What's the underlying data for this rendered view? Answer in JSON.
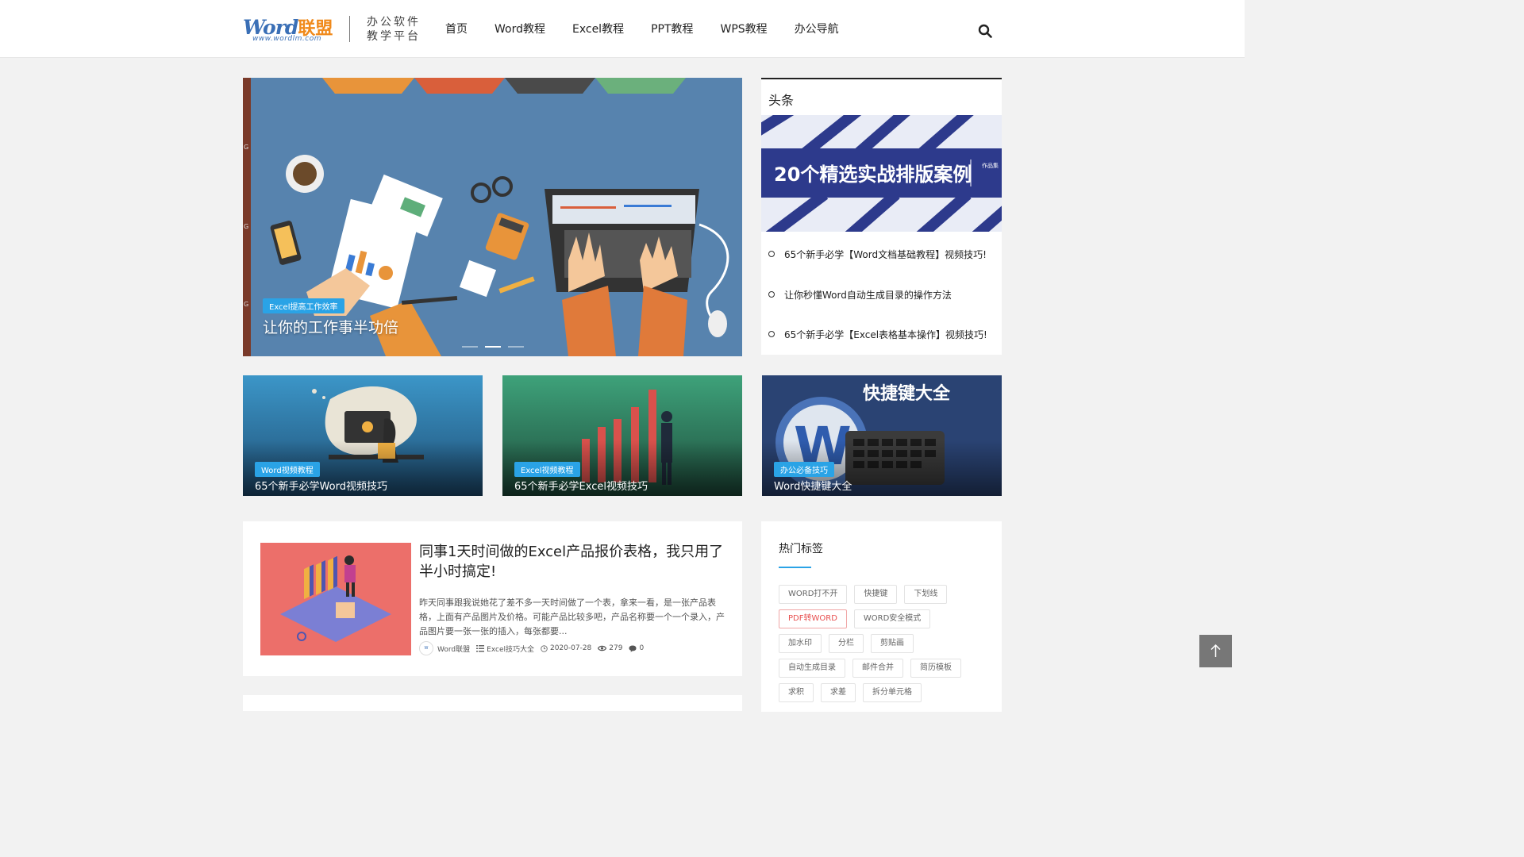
{
  "header": {
    "logo_word": "Word",
    "logo_lm": "联盟",
    "logo_url": "www.wordlm.com",
    "slogan_line1": "办公软件",
    "slogan_line2": "教学平台",
    "nav": [
      "首页",
      "Word教程",
      "Excel教程",
      "PPT教程",
      "WPS教程",
      "办公导航"
    ],
    "search_icon": "search-icon"
  },
  "hero": {
    "tag": "Excel提高工作效率",
    "title": "让你的工作事半功倍",
    "slide_count": 3,
    "active_slide": 2
  },
  "headlines": {
    "title": "头条",
    "banner_text": "20个精选实战排版案例",
    "banner_side": "作品集",
    "items": [
      "65个新手必学【Word文档基础教程】视频技巧!",
      "让你秒懂Word自动生成目录的操作方法",
      "65个新手必学【Excel表格基本操作】视频技巧!"
    ]
  },
  "cards": [
    {
      "tag": "Word视频教程",
      "title": "65个新手必学Word视频技巧"
    },
    {
      "tag": "Excel视频教程",
      "title": "65个新手必学Excel视频技巧"
    },
    {
      "tag": "办公必备技巧",
      "title": "Word快捷键大全",
      "image_text": "快捷键大全"
    }
  ],
  "article": {
    "title": "同事1天时间做的Excel产品报价表格，我只用了半小时搞定!",
    "excerpt": "昨天同事跟我说她花了差不多一天时间做了一个表，拿来一看，是一张产品表格，上面有产品图片及价格。可能产品比较多吧，产品名称要一个一个录入，产品图片要一张一张的插入，每张都要...",
    "author": "Word联盟",
    "category": "Excel技巧大全",
    "date": "2020-07-28",
    "views": "279",
    "comments": "0"
  },
  "hot_tags": {
    "title": "热门标签",
    "rows": [
      [
        "WORD打不开",
        "快捷键",
        "下划线"
      ],
      [
        "PDF转WORD",
        "WORD安全模式"
      ],
      [
        "加水印",
        "分栏",
        "剪贴画"
      ],
      [
        "自动生成目录",
        "邮件合并",
        "简历模板"
      ],
      [
        "求积",
        "求差",
        "拆分单元格"
      ]
    ],
    "highlight": "PDF转WORD"
  },
  "colors": {
    "accent": "#2aa3e6",
    "hero_bg": "#5783ae",
    "hot_tag": "#e85050"
  }
}
